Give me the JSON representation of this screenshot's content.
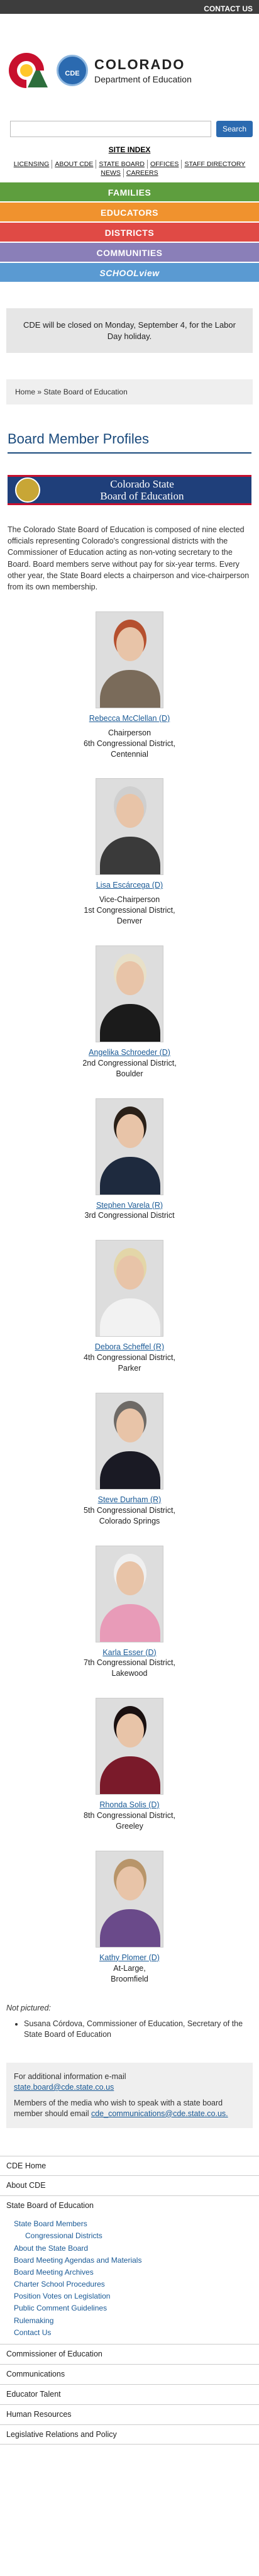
{
  "topbar": {
    "contact": "CONTACT US"
  },
  "logo": {
    "line1": "COLORADO",
    "line2": "Department of Education",
    "badge": "CDE"
  },
  "search": {
    "placeholder": "",
    "button": "Search"
  },
  "site_index": "SITE INDEX",
  "util_links": [
    "LICENSING",
    "ABOUT CDE",
    "STATE BOARD",
    "OFFICES",
    "STAFF DIRECTORY",
    "NEWS",
    "CAREERS"
  ],
  "audience": {
    "families": "FAMILIES",
    "educators": "EDUCATORS",
    "districts": "DISTRICTS",
    "communities": "COMMUNITIES",
    "schoolview": "SCHOOLview"
  },
  "alert": "CDE will be closed on Monday, September 4, for the Labor Day holiday.",
  "breadcrumb": "Home » State Board of Education",
  "page_title": "Board Member Profiles",
  "banner": {
    "line1": "Colorado State",
    "line2": "Board of Education"
  },
  "intro": "The Colorado State Board of Education is composed of nine elected officials representing Colorado's congressional districts with the Commissioner of Education acting as non-voting secretary to the Board. Board members serve without pay for six-year terms. Every other year, the State Board elects a chairperson and vice-chairperson from its own membership.",
  "members": [
    {
      "name": "Rebecca McClellan (D)",
      "role": "Chairperson",
      "district": "6th Congressional District,",
      "location": "Centennial",
      "hair": "#b5502f",
      "clothes": "#7a6b5a"
    },
    {
      "name": "Lisa Escárcega (D)",
      "role": "Vice-Chairperson",
      "district": "1st Congressional District,",
      "location": "Denver",
      "hair": "#cfcfcf",
      "clothes": "#3a3a3a"
    },
    {
      "name": "Angelika Schroeder (D)",
      "role": "",
      "district": "2nd Congressional District,",
      "location": "Boulder",
      "hair": "#e8e0c8",
      "clothes": "#1b1b1b"
    },
    {
      "name": "Stephen Varela (R)",
      "role": "",
      "district": "3rd Congressional District",
      "location": "",
      "hair": "#2a2018",
      "clothes": "#1e2a3e"
    },
    {
      "name": "Debora Scheffel (R)",
      "role": "",
      "district": "4th Congressional District,",
      "location": "Parker",
      "hair": "#e3d6a8",
      "clothes": "#f2f2f2"
    },
    {
      "name": "Steve Durham (R)",
      "role": "",
      "district": "5th Congressional District,",
      "location": "Colorado Springs",
      "hair": "#6e6a66",
      "clothes": "#1a1a24"
    },
    {
      "name": "Karla Esser (D)",
      "role": "",
      "district": "7th Congressional District,",
      "location": "Lakewood",
      "hair": "#f0f0f0",
      "clothes": "#e89bb8"
    },
    {
      "name": "Rhonda Solis (D)",
      "role": "",
      "district": "8th Congressional District,",
      "location": "Greeley",
      "hair": "#1a1010",
      "clothes": "#7a1a2a"
    },
    {
      "name": "Kathy Plomer (D)",
      "role": "",
      "district": "At-Large,",
      "location": "Broomfield",
      "hair": "#b8956a",
      "clothes": "#6a4a8a"
    }
  ],
  "not_pictured_label": "Not pictured:",
  "not_pictured": [
    "Susana Córdova, Commissioner of Education, Secretary of the State Board of Education"
  ],
  "info": {
    "line1": "For additional information e-mail",
    "email1": "state.board@cde.state.co.us",
    "line2": "Members of the media who wish to speak with a state board member should email",
    "email2": "cde_communications@cde.state.co.us."
  },
  "nav": {
    "home": "CDE Home",
    "about": "About CDE",
    "state_board": "State Board of Education",
    "members_label": "State Board Members",
    "cong_districts": "Congressional Districts",
    "sub_items": [
      "About the State Board",
      "Board Meeting Agendas and Materials",
      "Board Meeting Archives",
      "Charter School Procedures",
      "Position Votes on Legislation",
      "Public Comment Guidelines",
      "Rulemaking",
      "Contact Us"
    ],
    "commissioner": "Commissioner of Education",
    "communications": "Communications",
    "educator_talent": "Educator Talent",
    "human_resources": "Human Resources",
    "legislative": "Legislative Relations and Policy"
  }
}
